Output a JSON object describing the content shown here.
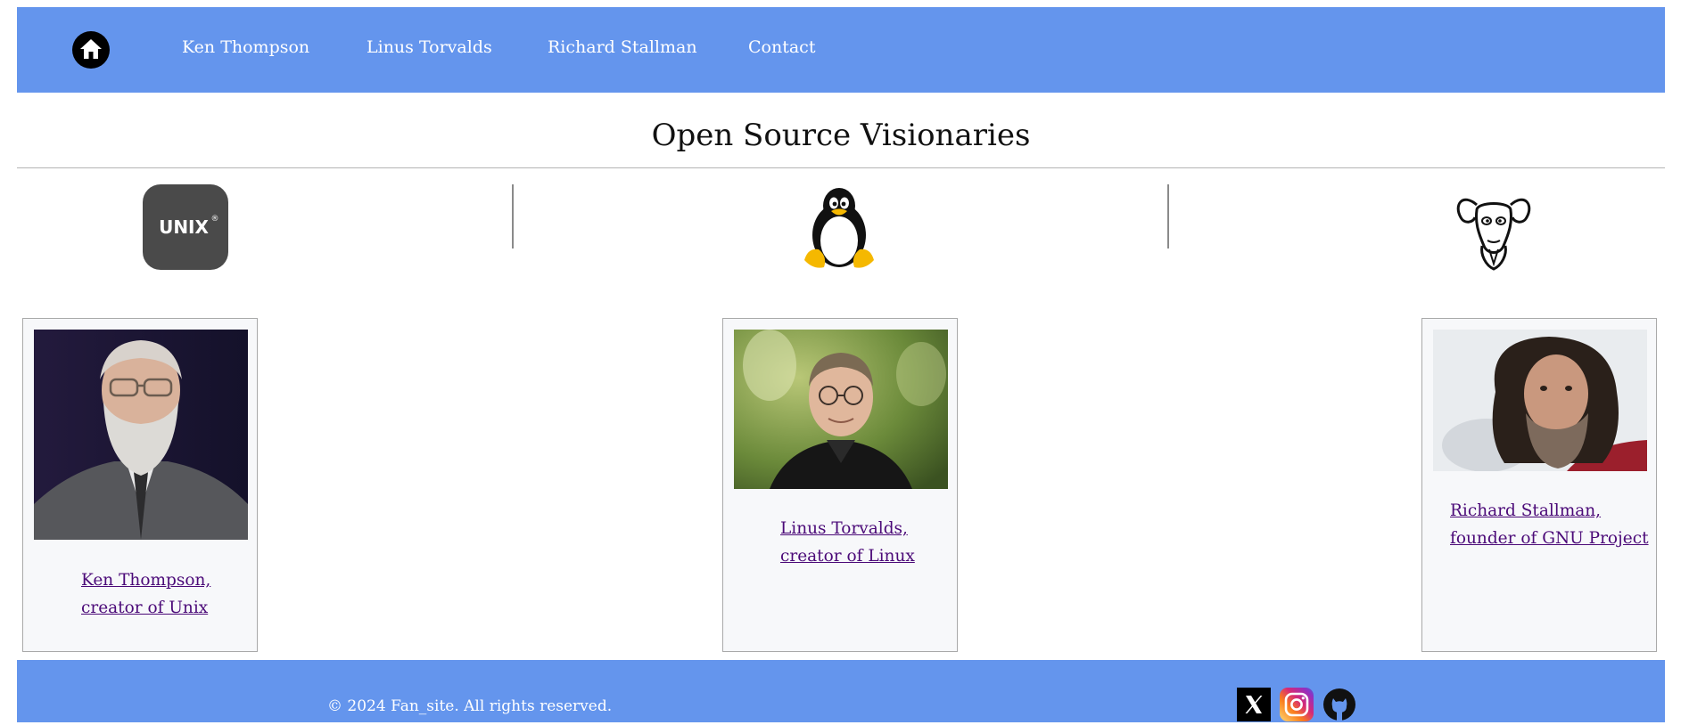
{
  "nav": {
    "home_icon": "home-icon",
    "links": [
      "Ken Thompson",
      "Linus Torvalds",
      "Richard Stallman",
      "Contact"
    ]
  },
  "page": {
    "title": "Open Source Visionaries"
  },
  "logos": {
    "unix": {
      "icon": "unix-logo",
      "text": "UNIX",
      "mark": "®"
    },
    "linux": {
      "icon": "tux-penguin-logo"
    },
    "gnu": {
      "icon": "gnu-head-logo"
    }
  },
  "cards": [
    {
      "name": "Ken Thompson",
      "caption_line1": "Ken Thompson,",
      "caption_line2": "creator of Unix"
    },
    {
      "name": "Linus Torvalds",
      "caption_line1": "Linus Torvalds,",
      "caption_line2": "creator of Linux"
    },
    {
      "name": "Richard Stallman",
      "caption_line1": "Richard Stallman,",
      "caption_line2": "founder of GNU Project"
    }
  ],
  "footer": {
    "copyright": "© 2024 Fan_site. All rights reserved.",
    "social": [
      "x-icon",
      "instagram-icon",
      "github-icon"
    ]
  },
  "colors": {
    "nav_bg": "#6495ed",
    "footer_bg": "#6495ed",
    "visited_link": "#4b0a78"
  }
}
